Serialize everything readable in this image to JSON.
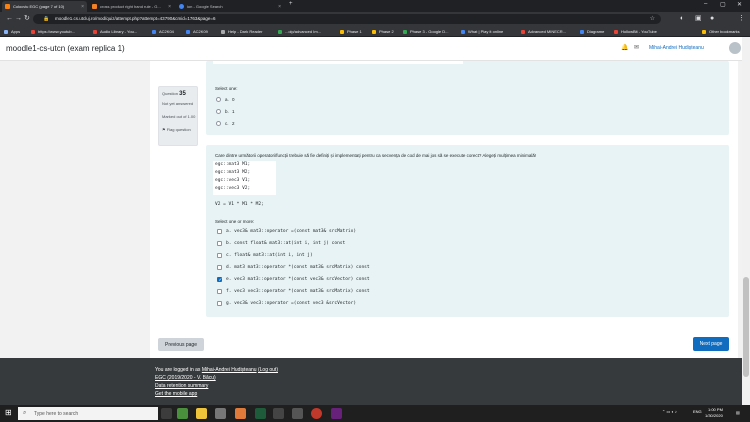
{
  "browser": {
    "tabs": [
      {
        "label": "Colocviu EGC (page 7 of 10)",
        "active": true
      },
      {
        "label": "cross product right hand rule - G...",
        "active": false
      },
      {
        "label": "ion - Google Search",
        "active": false
      }
    ],
    "new_tab": "+",
    "url": "moodle1.cs.utcluj.ro/mod/quiz/attempt.php?attempt=43790&cmid=1763&page=6",
    "bookmarks": [
      {
        "label": "Apps",
        "color": "#8ab4f8"
      },
      {
        "label": "https://www.youtub...",
        "color": "#ea4335"
      },
      {
        "label": "Audio Library - You...",
        "color": "#ea4335"
      },
      {
        "label": "AC2K04",
        "color": "#4285f4"
      },
      {
        "label": "AC2K09",
        "color": "#4285f4"
      },
      {
        "label": "Help - Dark Reader",
        "color": "#aaaaaa"
      },
      {
        "label": "...olp/advanced Im...",
        "color": "#34a853"
      },
      {
        "label": "Phase 1",
        "color": "#fbbc04"
      },
      {
        "label": "Phase 2",
        "color": "#fbbc04"
      },
      {
        "label": "Phase 3 - Google D...",
        "color": "#34a853"
      },
      {
        "label": "What | Play it online",
        "color": "#4285f4"
      },
      {
        "label": "Advanced MINECR...",
        "color": "#ea4335"
      },
      {
        "label": "Diagrame",
        "color": "#4285f4"
      },
      {
        "label": "HollowBit - YouTube",
        "color": "#ea4335"
      }
    ],
    "other_bookmarks": "Other bookmarks"
  },
  "moodle": {
    "site_title": "moodle1-cs-utcn (exam replica 1)",
    "user_name": "Mihai-Andrei Hudișteanu"
  },
  "prev_question": {
    "select_one": "Select one:",
    "options": [
      {
        "letter": "a.",
        "text": "0"
      },
      {
        "letter": "b.",
        "text": "1"
      },
      {
        "letter": "c.",
        "text": "2"
      }
    ]
  },
  "question": {
    "label": "Question",
    "number": "35",
    "status": "Not yet answered",
    "marked": "Marked out of 1.00",
    "flag": "Flag question",
    "text": "Care dintre următorii operatori/funcții trebuie să fie definiți și implementați pentru ca secvența de cod de mai jos să se execute corect? Alegeți mulțimea minimală!",
    "code_lines": [
      "egc::mat3 M1;",
      "egc::mat3 M2;",
      "egc::vec3 V1;",
      "egc::vec3 V2;",
      "",
      "V2 = V1 * M1 * M2;"
    ],
    "select_instruction": "Select one or more:",
    "options": [
      {
        "letter": "a.",
        "text": "vec3& mat3::operator =(const mat3& srcMatrix)",
        "checked": false
      },
      {
        "letter": "b.",
        "text": "const float& mat3::at(int i, int j) const",
        "checked": false
      },
      {
        "letter": "c.",
        "text": "float& mat3::at(int i, int j)",
        "checked": false
      },
      {
        "letter": "d.",
        "text": "mat3 mat3::operator *(const mat3& srcMatrix) const",
        "checked": false
      },
      {
        "letter": "e.",
        "text": "vec3 mat3::operator *(const vec3& srcVector) const",
        "checked": true
      },
      {
        "letter": "f.",
        "text": "vec3 vec3::operator *(const mat3& srcMatrix) const",
        "checked": false
      },
      {
        "letter": "g.",
        "text": "vec3& vec3::operator =(const vec3 &srcVector)",
        "checked": false
      }
    ]
  },
  "nav": {
    "prev": "Previous page",
    "next": "Next page"
  },
  "footer": {
    "logged_in_prefix": "You are logged in as",
    "user": "Mihai-Andrei Hudișteanu",
    "logout": "(Log out)",
    "course": "EGC (2019/2020 - V. Bâcu)",
    "retention": "Data retention summary",
    "mobile": "Get the mobile app"
  },
  "taskbar": {
    "search_placeholder": "Type here to search",
    "time": "1:00 PM",
    "date": "1/30/2020",
    "lang": "ENG"
  }
}
